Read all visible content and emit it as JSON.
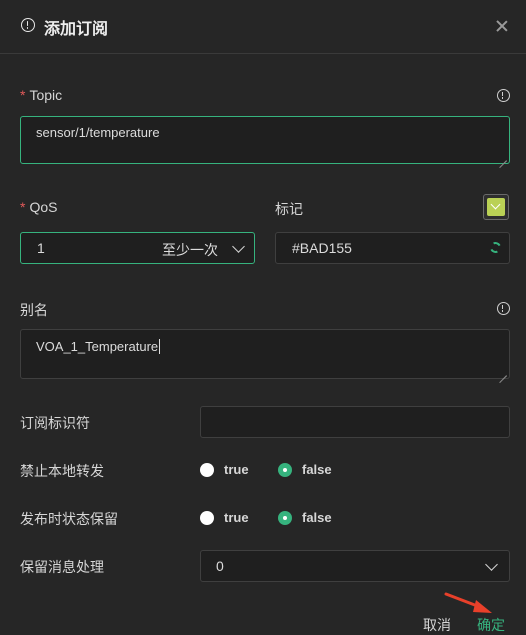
{
  "dialog": {
    "title": "添加订阅"
  },
  "topic": {
    "required_mark": "*",
    "label": "Topic",
    "value": "sensor/1/temperature"
  },
  "qos": {
    "required_mark": "*",
    "label": "QoS",
    "value": "1",
    "description": "至少一次"
  },
  "tag": {
    "label": "标记",
    "value": "#BAD155",
    "swatch_color": "#BAD155"
  },
  "alias": {
    "label": "别名",
    "value": "VOA_1_Temperature"
  },
  "subscription_identifier": {
    "label": "订阅标识符",
    "value": ""
  },
  "no_local": {
    "label": "禁止本地转发",
    "options": [
      "true",
      "false"
    ],
    "selected": "false"
  },
  "retain_as_published": {
    "label": "发布时状态保留",
    "options": [
      "true",
      "false"
    ],
    "selected": "false"
  },
  "retain_handling": {
    "label": "保留消息处理",
    "value": "0"
  },
  "footer": {
    "cancel_label": "取消",
    "confirm_label": "确定"
  },
  "colors": {
    "accent": "#36b37e",
    "background": "#262626",
    "required": "#e25a5a",
    "annotation_arrow": "#e8402a"
  }
}
